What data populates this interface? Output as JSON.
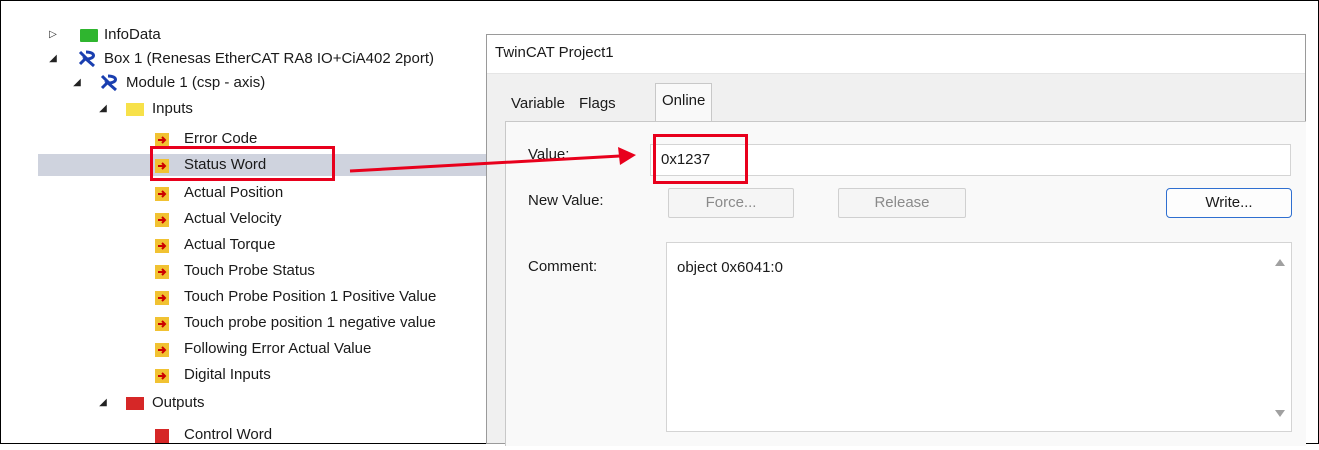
{
  "tree": {
    "items": [
      {
        "label": "InfoData",
        "arrow": "▷"
      },
      {
        "label": "Box 1 (Renesas EtherCAT RA8 IO+CiA402 2port)",
        "arrow": "◢"
      },
      {
        "label": "Module 1 (csp - axis)",
        "arrow": "◢"
      },
      {
        "label": "Inputs",
        "arrow": "◢"
      },
      {
        "label": "Error Code"
      },
      {
        "label": "Status Word"
      },
      {
        "label": "Actual Position"
      },
      {
        "label": "Actual Velocity"
      },
      {
        "label": "Actual Torque"
      },
      {
        "label": "Touch Probe Status"
      },
      {
        "label": "Touch Probe Position 1 Positive Value"
      },
      {
        "label": "Touch probe position 1 negative value"
      },
      {
        "label": "Following Error Actual Value"
      },
      {
        "label": "Digital Inputs"
      },
      {
        "label": "Outputs",
        "arrow": "◢"
      },
      {
        "label": "Control Word"
      }
    ]
  },
  "dialog": {
    "title": "TwinCAT Project1",
    "tabs": [
      "Variable",
      "Flags",
      "Online"
    ],
    "active_tab": "Online",
    "value_label": "Value:",
    "value": "0x1237",
    "new_value_label": "New Value:",
    "force_button": "Force...",
    "release_button": "Release",
    "write_button": "Write...",
    "comment_label": "Comment:",
    "comment": "object 0x6041:0"
  },
  "colors": {
    "highlight": "#e8001c",
    "selection": "#cfd3de",
    "write_border": "#2f6fd0"
  }
}
